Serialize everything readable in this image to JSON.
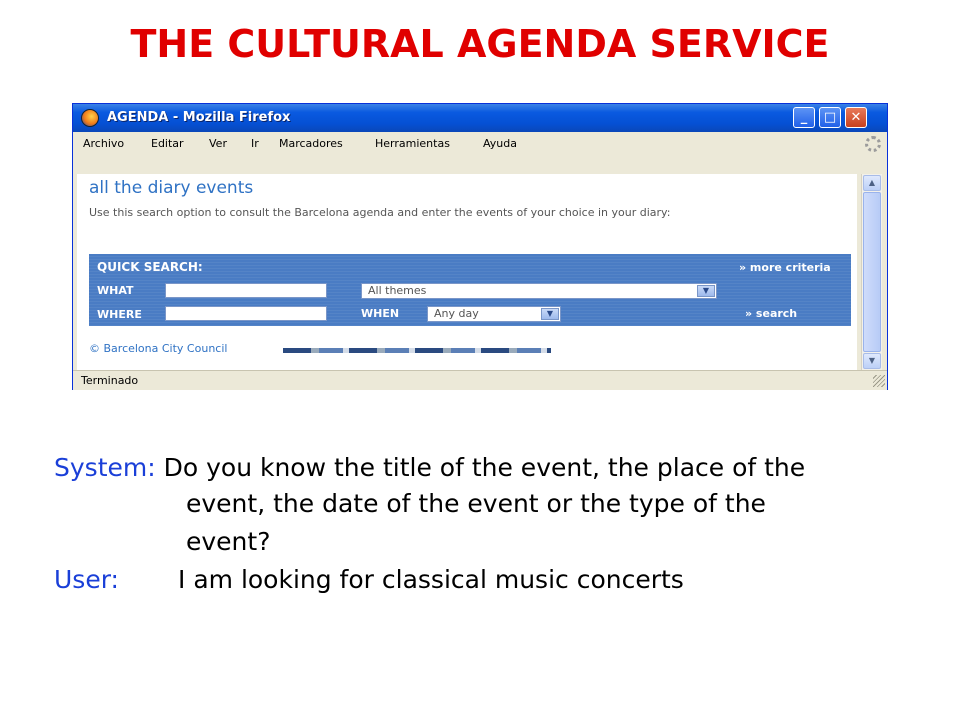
{
  "slide": {
    "title": "THE CULTURAL AGENDA SERVICE"
  },
  "window": {
    "title": "AGENDA - Mozilla Firefox",
    "controls": {
      "minimize": "_",
      "maximize": "□",
      "close": "✕"
    }
  },
  "menubar": {
    "items": [
      "Archivo",
      "Editar",
      "Ver",
      "Ir",
      "Marcadores",
      "Herramientas",
      "Ayuda"
    ]
  },
  "page": {
    "heading": "all the diary events",
    "description": "Use this search option to consult the Barcelona agenda and enter the events of your choice in your diary:",
    "quick_search": {
      "title": "QUICK SEARCH:",
      "more_criteria": "» more criteria",
      "what_label": "WHAT",
      "where_label": "WHERE",
      "when_label": "WHEN",
      "what_value": "",
      "where_value": "",
      "theme_selected": "All themes",
      "day_selected": "Any day",
      "search_link": "» search"
    },
    "footer": "© Barcelona City Council"
  },
  "statusbar": {
    "text": "Terminado"
  },
  "dialogue": {
    "system_speaker": "System:",
    "system_line1": "Do you know the title of the event, the place of the",
    "system_line2": "event, the date of the event or the type of the",
    "system_line3": "event?",
    "user_speaker": "User:",
    "user_line": "I am looking for classical music concerts"
  },
  "colors": {
    "title_red": "#e00000",
    "speaker_blue": "#1a3fd8",
    "panel_blue": "#4a7cc4",
    "link_blue": "#2f72c4"
  }
}
